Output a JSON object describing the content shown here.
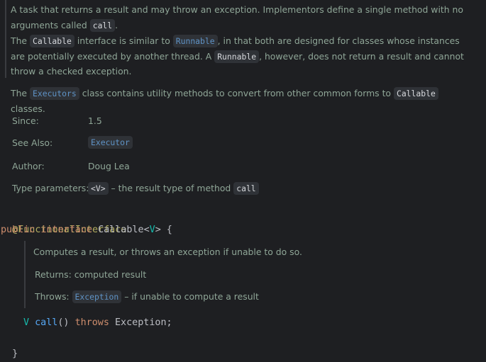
{
  "doc_top": {
    "p1_text": "A task that returns a result and may throw an exception. Implementors define a single method with no arguments called",
    "p1_chip": "call",
    "p1_end": ".",
    "p2_a": "The",
    "p2_chip1": "Callable",
    "p2_b": "interface is similar to",
    "p2_chip2": "Runnable",
    "p2_c": ", in that both are designed for classes whose instances are potentially executed by another thread. A",
    "p2_chip3": "Runnable",
    "p2_d": ", however, does not return a result and cannot throw a checked exception.",
    "p3_a": "The",
    "p3_chip1": "Executors",
    "p3_b": "class contains utility methods to convert from other common forms to",
    "p3_chip2": "Callable",
    "p3_c": "classes."
  },
  "meta": {
    "since_label": "Since:",
    "since_value": "1.5",
    "see_also_label": "See Also:",
    "see_also_value": "Executor",
    "author_label": "Author:",
    "author_value": "Doug Lea",
    "type_params_label": "Type parameters:",
    "type_params_chip": "<V>",
    "type_params_text": "– the result type of method",
    "type_params_chip2": "call"
  },
  "code": {
    "annotation": "@FunctionalInterface",
    "kw_public": "public",
    "kw_interface": "interface",
    "class_name": "Callable",
    "lt": "<",
    "type_param": "V",
    "gt_brace": "> {",
    "method_return": "V",
    "method_name": "call",
    "method_parens": "()",
    "kw_throws": "throws",
    "exception": "Exception;",
    "close_brace": "}"
  },
  "doc_inner": {
    "summary": "Computes a result, or throws an exception if unable to do so.",
    "returns_label": "Returns:",
    "returns_text": "computed result",
    "throws_label": "Throws:",
    "throws_chip": "Exception",
    "throws_text": "– if unable to compute a result"
  },
  "colors": {
    "background": "#1e1f22",
    "doc_text": "#8fa697",
    "chip_bg": "#2f3237",
    "link": "#5f93c6",
    "annotation": "#b3ae60",
    "keyword": "#cf8e6d",
    "type_param": "#16baac",
    "method": "#56a8f5",
    "plain": "#bcbec4"
  }
}
